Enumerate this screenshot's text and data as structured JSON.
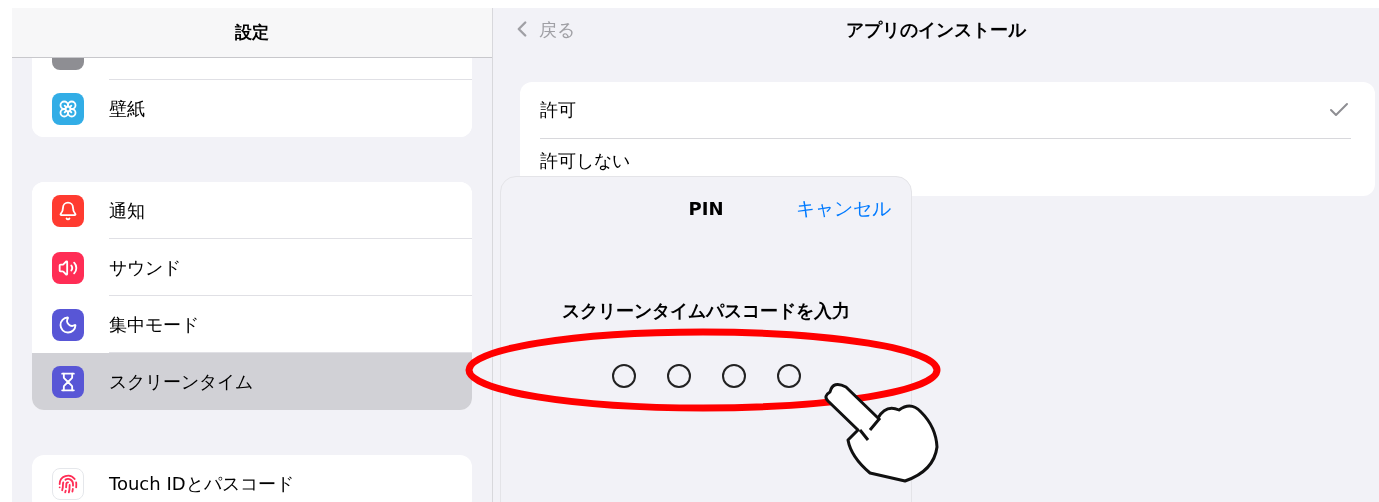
{
  "sidebar": {
    "title": "設定",
    "groups": [
      {
        "clipped_top": true,
        "items": [
          {
            "label": "壁紙",
            "kind": "wallpaper",
            "selected": false
          }
        ]
      },
      {
        "items": [
          {
            "label": "通知",
            "kind": "notifications",
            "selected": false
          },
          {
            "label": "サウンド",
            "kind": "sounds",
            "selected": false
          },
          {
            "label": "集中モード",
            "kind": "focus",
            "selected": false
          },
          {
            "label": "スクリーンタイム",
            "kind": "screen_time",
            "selected": true
          }
        ]
      },
      {
        "items": [
          {
            "label": "Touch IDとパスコード",
            "kind": "touch_id",
            "selected": false
          }
        ]
      }
    ]
  },
  "detail": {
    "back": "戻る",
    "title": "アプリのインストール",
    "options": [
      {
        "label": "許可",
        "selected": true
      },
      {
        "label": "許可しない",
        "selected": false
      }
    ]
  },
  "pin_sheet": {
    "title": "PIN",
    "cancel": "キャンセル",
    "prompt": "スクリーンタイムパスコードを入力",
    "digits": [
      {
        "filled": false
      },
      {
        "filled": false
      },
      {
        "filled": false
      },
      {
        "filled": false
      }
    ]
  }
}
